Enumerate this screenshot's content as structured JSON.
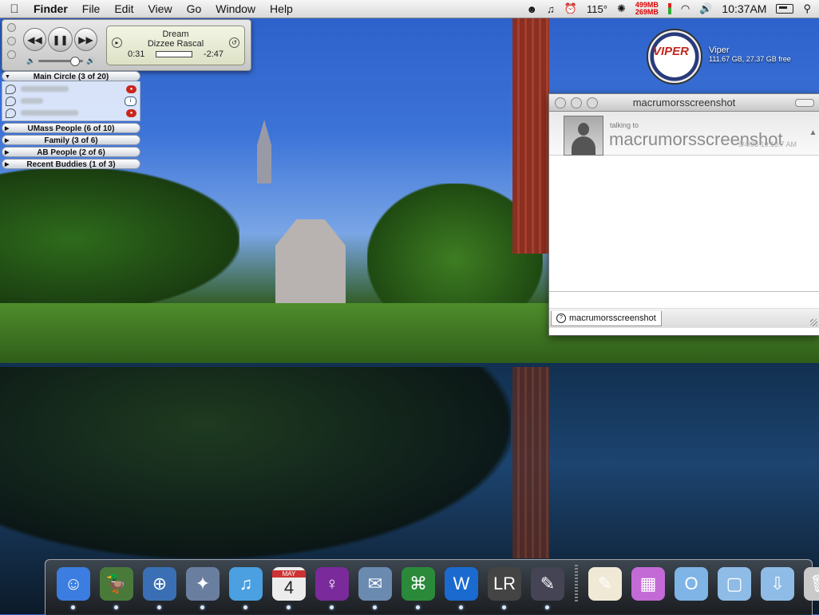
{
  "menubar": {
    "app": "Finder",
    "items": [
      "File",
      "Edit",
      "View",
      "Go",
      "Window",
      "Help"
    ],
    "status": {
      "temperature": "115°",
      "mem_used": "499MB",
      "mem_free": "269MB",
      "time": "10:37AM"
    }
  },
  "itunes": {
    "song": "Dream",
    "artist": "Dizzee Rascal",
    "elapsed": "0:31",
    "remaining": "-2:47",
    "progress": 0.16,
    "volume": 0.85
  },
  "buddy_list": {
    "groups": [
      {
        "label": "Main Circle (3 of 20)",
        "expanded": true,
        "members": [
          {
            "status": "away",
            "badge": "red"
          },
          {
            "status": "info",
            "badge": "blue"
          },
          {
            "status": "away",
            "badge": "red"
          }
        ]
      },
      {
        "label": "UMass People (6 of 10)",
        "expanded": false
      },
      {
        "label": "Family (3 of 6)",
        "expanded": false
      },
      {
        "label": "AB People (2 of 6)",
        "expanded": false
      },
      {
        "label": "Recent Buddies (1 of 3)",
        "expanded": false
      }
    ]
  },
  "desktop": {
    "drive": {
      "name": "Viper",
      "logo_text": "VIPER",
      "capacity": "111.67 GB, 27.37 GB free"
    }
  },
  "chat_window": {
    "title": "macrumorsscreenshot",
    "talking_to_label": "talking to",
    "contact": "macrumorsscreenshot",
    "timestamp": "5/4/08 10:18:7 AM",
    "tab_label": "macrumorsscreenshot"
  },
  "dock": {
    "items": [
      {
        "icon": "finder-icon",
        "glyph": "☺",
        "color": "#3b7de0"
      },
      {
        "icon": "adium-duck-icon",
        "glyph": "🦆",
        "color": "#4a7a3a"
      },
      {
        "icon": "safari-icon",
        "glyph": "⊕",
        "color": "#3a6fb5"
      },
      {
        "icon": "network-compass-icon",
        "glyph": "✦",
        "color": "#6a7fa0"
      },
      {
        "icon": "itunes-icon",
        "glyph": "♫",
        "color": "#4aa0e0"
      },
      {
        "icon": "ical-icon",
        "glyph": "4",
        "color": "#ececec",
        "label": "MAY"
      },
      {
        "icon": "circle-app-icon",
        "glyph": "♀",
        "color": "#7a2a9a"
      },
      {
        "icon": "mail-stamp-icon",
        "glyph": "✉",
        "color": "#6a8ab0"
      },
      {
        "icon": "map-app-icon",
        "glyph": "⌘",
        "color": "#2a8a3a"
      },
      {
        "icon": "word-icon",
        "glyph": "W",
        "color": "#1a6ad0"
      },
      {
        "icon": "lightroom-icon",
        "glyph": "LR",
        "color": "#444"
      },
      {
        "icon": "quill-app-icon",
        "glyph": "✎",
        "color": "#445"
      },
      {
        "icon": "textedit-icon",
        "glyph": "✎",
        "color": "#efe9d6"
      },
      {
        "icon": "photo-downloads-icon",
        "glyph": "▦",
        "color": "#c46ad6"
      },
      {
        "icon": "office-folder-icon",
        "glyph": "O",
        "color": "#7fb4e6"
      },
      {
        "icon": "documents-folder-icon",
        "glyph": "▢",
        "color": "#8fbce6"
      },
      {
        "icon": "downloads-folder-icon",
        "glyph": "⇩",
        "color": "#8fbce6"
      },
      {
        "icon": "trash-icon",
        "glyph": "🗑",
        "color": "#c9c9c9"
      }
    ]
  }
}
